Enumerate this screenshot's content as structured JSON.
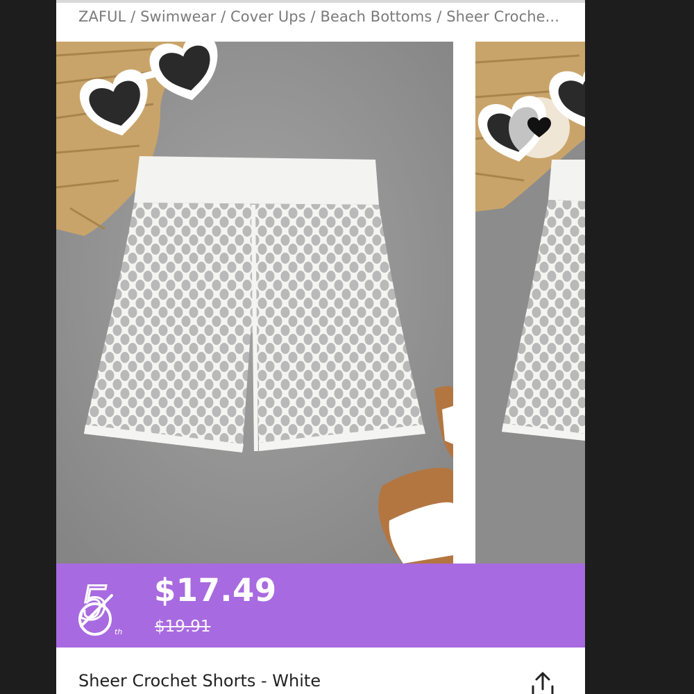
{
  "breadcrumb": {
    "text": "ZAFUL / Swimwear / Cover Ups / Beach Bottoms / Sheer Croche..."
  },
  "gallery": {
    "main_image_alt": "Sheer Crochet Shorts - White",
    "next_image_alt": "Sheer Crochet Shorts - White alternate view",
    "favorite_icon": "heart-icon"
  },
  "price_banner": {
    "badge_icon": "fifth-anniversary-badge-icon",
    "badge_text": "5",
    "badge_suffix": "th",
    "price": "$17.49",
    "original_price": "$19.91",
    "background_color": "#a86ae0"
  },
  "product": {
    "title": "Sheer Crochet Shorts - White",
    "share_icon": "share-icon"
  }
}
